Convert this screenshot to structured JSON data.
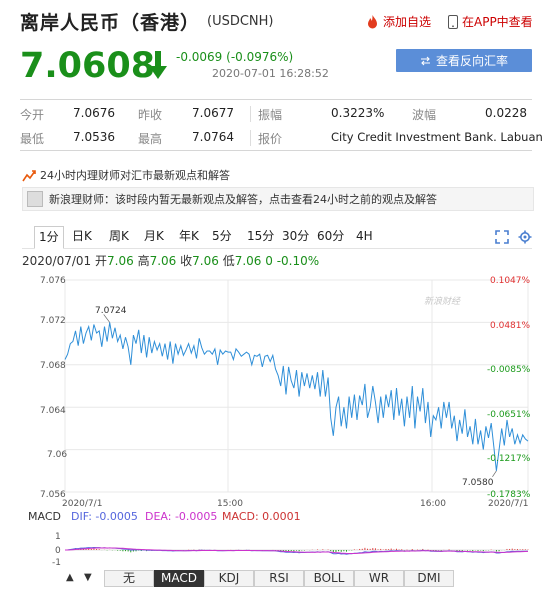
{
  "header": {
    "title": "离岸人民币（香港）",
    "code": "(USDCNH)",
    "add_favorite": "添加自选",
    "app_view": "在APP中查看"
  },
  "quote": {
    "price": "7.0608",
    "change": "-0.0069 (-0.0976%)",
    "timestamp": "2020-07-01 16:28:52",
    "reverse_button": "查看反向汇率"
  },
  "stats": {
    "row1": [
      {
        "label": "今开",
        "value": "7.0676"
      },
      {
        "label": "昨收",
        "value": "7.0677"
      },
      {
        "label": "振幅",
        "value": "0.3223%"
      },
      {
        "label": "波幅",
        "value": "0.0228"
      }
    ],
    "row2": [
      {
        "label": "最低",
        "value": "7.0536"
      },
      {
        "label": "最高",
        "value": "7.0764"
      },
      {
        "label": "报价",
        "value": "City Credit Investment Bank. Labuan"
      }
    ]
  },
  "news": {
    "headline": "24小时内理财师对汇市最新观点和解答",
    "message": "新浪理财师：该时段内暂无最新观点及解答，点击查看24小时之前的观点及解答"
  },
  "chart_tabs": [
    "1分",
    "日K",
    "周K",
    "月K",
    "年K",
    "5分",
    "15分",
    "30分",
    "60分",
    "4H"
  ],
  "chart_info": {
    "date": "2020/07/01",
    "open_label": "开",
    "open": "7.06",
    "high_label": "高",
    "high": "7.06",
    "close_label": "收",
    "close": "7.06",
    "low_label": "低",
    "low": "7.06",
    "change": "0 -0.10%"
  },
  "watermark": "新浪财经",
  "chart_data": {
    "type": "line",
    "title": "",
    "yticks": [
      "7.076",
      "7.072",
      "7.068",
      "7.064",
      "7.06",
      "7.056"
    ],
    "ylim": [
      7.056,
      7.076
    ],
    "percent_ticks": [
      "0.1047%",
      "0.0481%",
      "-0.0085%",
      "-0.0651%",
      "-0.1217%",
      "-0.1783%"
    ],
    "xticks": [
      "2020/7/1",
      "15:00",
      "16:00",
      "2020/7/1"
    ],
    "annotations": {
      "max": "7.0724",
      "min": "7.0580"
    },
    "series": [
      {
        "values": [
          7.0685,
          7.069,
          7.07,
          7.0702,
          7.0712,
          7.0698,
          7.0716,
          7.07,
          7.071,
          7.0716,
          7.0703,
          7.0718,
          7.071,
          7.0712,
          7.0697,
          7.0716,
          7.0702,
          7.072,
          7.0705,
          7.0715,
          7.0702,
          7.0708,
          7.0695,
          7.0706,
          7.0697,
          7.068,
          7.0708,
          7.07,
          7.0713,
          7.0691,
          7.0708,
          7.0687,
          7.0706,
          7.0691,
          7.0702,
          7.0694,
          7.07,
          7.0688,
          7.07,
          7.0685,
          7.0702,
          7.0681,
          7.07,
          7.069,
          7.0698,
          7.0689,
          7.0694,
          7.07,
          7.0691,
          7.0698,
          7.0686,
          7.0705,
          7.0696,
          7.069,
          7.0693,
          7.0693,
          7.069,
          7.0695,
          7.068,
          7.0694,
          7.069,
          7.0693,
          7.0692,
          7.0692,
          7.0685,
          7.0695,
          7.0692,
          7.0688,
          7.069,
          7.0692,
          7.069,
          7.068,
          7.0689,
          7.0688,
          7.069,
          7.0678,
          7.0688,
          7.0689,
          7.0683,
          7.0689,
          7.0676,
          7.067,
          7.066,
          7.0679,
          7.0652,
          7.0678,
          7.0665,
          7.0658,
          7.0675,
          7.065,
          7.0673,
          7.066,
          7.0672,
          7.0658,
          7.067,
          7.0657,
          7.0673,
          7.065,
          7.0675,
          7.065,
          7.0668,
          7.063,
          7.0613,
          7.064,
          7.065,
          7.0622,
          7.064,
          7.062,
          7.065,
          7.063,
          7.0652,
          7.0628,
          7.0651,
          7.0642,
          7.0662,
          7.063,
          7.064,
          7.066,
          7.0645,
          7.0625,
          7.065,
          7.063,
          7.0652,
          7.064,
          7.0656,
          7.0628,
          7.0658,
          7.0632,
          7.0648,
          7.0622,
          7.065,
          7.063,
          7.066,
          7.062,
          7.065,
          7.0636,
          7.0658,
          7.0625,
          7.0645,
          7.0612,
          7.0632,
          7.0628,
          7.064,
          7.062,
          7.0645,
          7.063,
          7.0645,
          7.062,
          7.0632,
          7.0608,
          7.0628,
          7.0615,
          7.0638,
          7.0612,
          7.0622,
          7.0605,
          7.0629,
          7.0605,
          7.0618,
          7.06,
          7.0622,
          7.0611,
          7.0625,
          7.0603,
          7.058,
          7.06,
          7.062,
          7.0604,
          7.0628,
          7.0612,
          7.062,
          7.0605,
          7.0614,
          7.0606,
          7.0614,
          7.061,
          7.0608
        ]
      }
    ]
  },
  "macd": {
    "label": "MACD",
    "dif": "DIF: -0.0005",
    "dea": "DEA: -0.0005",
    "macd": "MACD: 0.0001",
    "scale": [
      "1",
      "0",
      "-1"
    ],
    "colors": {
      "dif": "#5566dd",
      "dea": "#cc33cc",
      "macd": "#cc3333"
    }
  },
  "indicator_tabs": [
    "无",
    "MACD",
    "KDJ",
    "RSI",
    "BOLL",
    "WR",
    "DMI"
  ],
  "nav_arrows": {
    "up": "▲",
    "down": "▼"
  }
}
